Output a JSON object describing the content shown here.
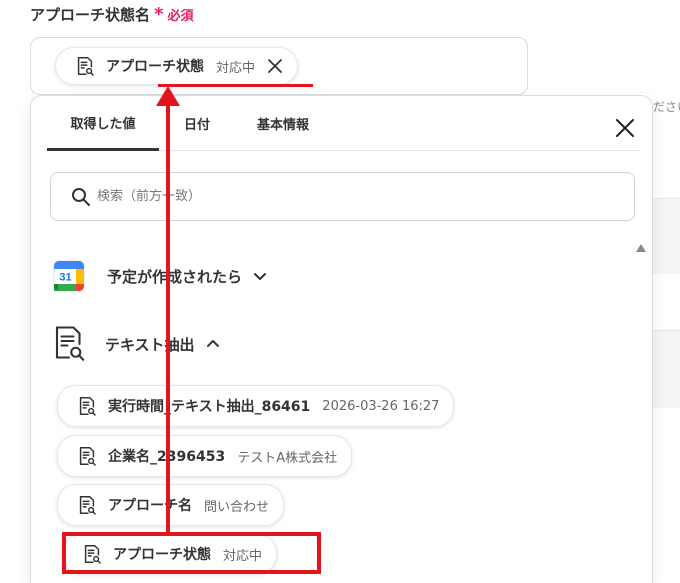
{
  "field": {
    "label": "アプローチ状態名",
    "asterisk": "*",
    "required": "必須",
    "selected_chip": {
      "name": "アプローチ状態",
      "value": "対応中"
    }
  },
  "background": {
    "right_text": "ださい"
  },
  "panel": {
    "tabs": [
      "取得した値",
      "日付",
      "基本情報"
    ],
    "search_placeholder": "検索（前方一致）",
    "sections": [
      {
        "label": "予定が作成されたら",
        "calendar_day": "31",
        "expanded": false
      },
      {
        "label": "テキスト抽出",
        "expanded": true
      }
    ],
    "items": [
      {
        "name": "実行時間_テキスト抽出_86461",
        "value": "2026-03-26 16:27"
      },
      {
        "name": "企業名_2396453",
        "value": "テストA株式会社"
      },
      {
        "name": "アプローチ名",
        "value": "問い合わせ"
      },
      {
        "name": "アプローチ状態",
        "value": "対応中"
      }
    ]
  },
  "colors": {
    "accent_red": "#e3141b",
    "required_pink": "#e0245e"
  },
  "icons": [
    "document-search-icon",
    "close-icon",
    "search-icon",
    "google-calendar-icon",
    "chevron-down-icon",
    "chevron-up-icon",
    "scroll-up-icon"
  ]
}
